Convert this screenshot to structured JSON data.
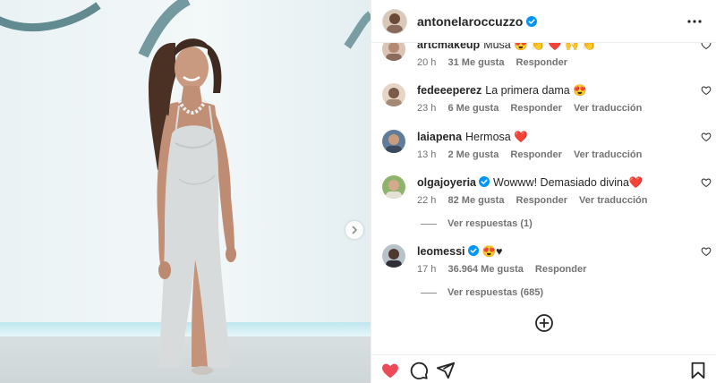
{
  "post": {
    "username": "antonelaroccuzzo",
    "verified": true,
    "liked": true
  },
  "comments": [
    {
      "username": "artcmakeup",
      "text": "Musa 😍 👏 ❤️ 🙌 👏",
      "time": "20 h",
      "likes": "31 Me gusta",
      "reply": "Responder"
    },
    {
      "username": "fedeeeperez",
      "text": "La primera dama 😍",
      "time": "23 h",
      "likes": "6 Me gusta",
      "reply": "Responder",
      "translate": "Ver traducción"
    },
    {
      "username": "laiapena",
      "text": "Hermosa ❤️",
      "time": "13 h",
      "likes": "2 Me gusta",
      "reply": "Responder",
      "translate": "Ver traducción"
    },
    {
      "username": "olgajoyeria",
      "verified": true,
      "text": "Wowww! Demasiado divina❤️",
      "time": "22 h",
      "likes": "82 Me gusta",
      "reply": "Responder",
      "translate": "Ver traducción",
      "view_replies": "Ver respuestas (1)"
    },
    {
      "username": "leomessi",
      "verified": true,
      "text": "😍♥",
      "time": "17 h",
      "likes": "36.964 Me gusta",
      "reply": "Responder",
      "view_replies": "Ver respuestas (685)"
    }
  ],
  "colors": {
    "like_red": "#ed4956",
    "verified_blue": "#0095f6",
    "text_primary": "#262626",
    "text_secondary": "#737373"
  },
  "icons": [
    "more-options-icon",
    "heart-icon",
    "comment-icon",
    "share-icon",
    "save-icon",
    "add-comment-icon",
    "chevron-right-icon",
    "verified-icon"
  ]
}
